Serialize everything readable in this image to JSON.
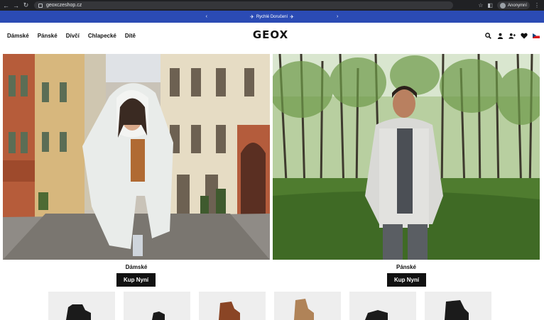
{
  "browser": {
    "url": "geoxczeshop.cz",
    "profile_label": "Anonymní",
    "nav": [
      "back-icon",
      "forward-icon",
      "reload-icon"
    ]
  },
  "promo": {
    "text": "Rychlé Doručení",
    "icons": [
      "airplane-icon",
      "chevron-left-icon",
      "chevron-right-icon"
    ]
  },
  "header": {
    "nav": [
      "Dámské",
      "Pánské",
      "Dívčí",
      "Chlapecké",
      "Dítě"
    ],
    "logo": "GEOX",
    "icons": [
      "search-icon",
      "user-icon",
      "add-user-icon",
      "heart-icon",
      "flag-cz-icon"
    ]
  },
  "hero": {
    "left": {
      "label": "Dámské",
      "cta": "Kup Nyní"
    },
    "right": {
      "label": "Pánské",
      "cta": "Kup Nyní"
    }
  },
  "colors": {
    "promo_bg": "#2b4bb4",
    "chrome_bg": "#202124",
    "cta_bg": "#111111"
  },
  "products": {
    "shoes": [
      "black-boot",
      "black-shoe",
      "brown-boot",
      "tan-boot",
      "black-sneaker",
      "black-boot"
    ]
  }
}
